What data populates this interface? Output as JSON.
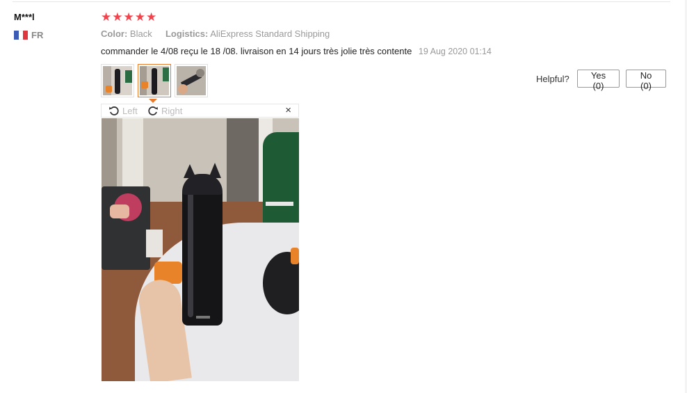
{
  "reviewer": {
    "name": "M***l",
    "country": "FR"
  },
  "rating": {
    "stars": 5,
    "max": 5,
    "color": "#f2424b"
  },
  "attributes": [
    {
      "label": "Color:",
      "value": "Black"
    },
    {
      "label": "Logistics:",
      "value": "AliExpress Standard Shipping"
    }
  ],
  "review": {
    "text": "commander le 4/08 reçu le 18 /08. livraison en 14 jours très jolie très contente",
    "date": "19 Aug 2020 01:14"
  },
  "photos": {
    "count": 3,
    "selected_index": 1
  },
  "viewer": {
    "rotate_left": "Left",
    "rotate_right": "Right",
    "close_icon": "×"
  },
  "helpful": {
    "label": "Helpful?",
    "yes": "Yes (0)",
    "no": "No (0)"
  },
  "colors": {
    "accent": "#e87c2e",
    "muted": "#999999"
  }
}
